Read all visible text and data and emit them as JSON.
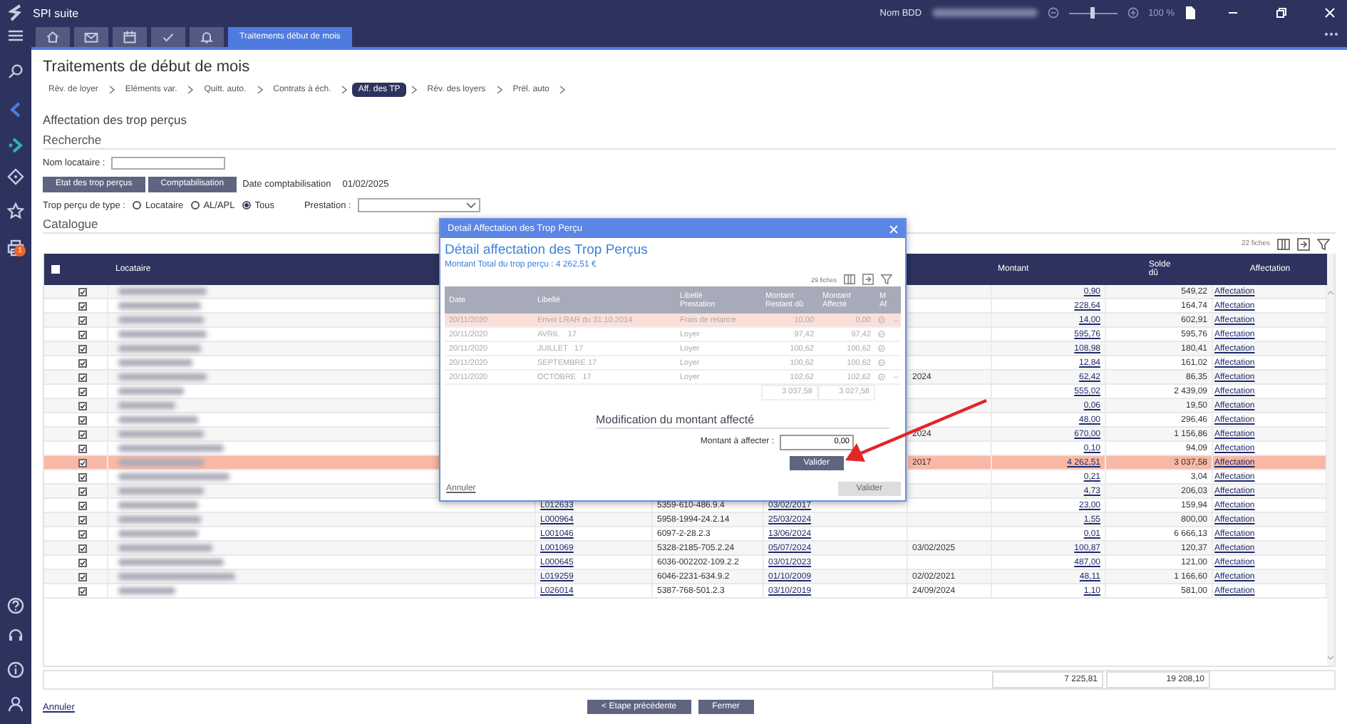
{
  "app": {
    "title": "SPI suite",
    "database_label": "Nom BDD",
    "zoom": {
      "level": 0.5,
      "reading": "100 %"
    }
  },
  "tabs": [
    {
      "kind": "icon",
      "selected": false
    },
    {
      "kind": "icon",
      "selected": false
    },
    {
      "kind": "icon",
      "selected": false
    },
    {
      "kind": "icon",
      "selected": false
    },
    {
      "kind": "icon",
      "selected": false
    },
    {
      "kind": "text",
      "label": "Traitements début de mois",
      "selected": true
    }
  ],
  "sidebar": {
    "notification_count": "1"
  },
  "page": {
    "title": "Traitements de début de mois",
    "section_title": "Affectation des trop perçus",
    "steps": [
      {
        "label": "Rév. de loyer",
        "selected": false
      },
      {
        "label": "Eléments var.",
        "selected": false
      },
      {
        "label": "Quitt. auto.",
        "selected": false
      },
      {
        "label": "Contrats à éch.",
        "selected": false
      },
      {
        "label": "Aff. des TP",
        "selected": true
      },
      {
        "label": "Rév. des loyers",
        "selected": false
      },
      {
        "label": "Prél. auto",
        "selected": false
      }
    ]
  },
  "search": {
    "heading": "Recherche",
    "name_label": "Nom locataire :",
    "buttons": [
      "Etat des trop perçus",
      "Comptabilisation"
    ],
    "date_label": "Date comptabilisation",
    "date_value": "01/02/2025",
    "type_label": "Trop perçu de type :",
    "type_options": [
      {
        "label": "Locataire",
        "selected": false
      },
      {
        "label": "AL/APL",
        "selected": false
      },
      {
        "label": "Tous",
        "selected": true
      }
    ],
    "prestation_label": "Prestation :"
  },
  "catalogue": {
    "heading": "Catalogue",
    "count": "22 fiches",
    "header_checked": false,
    "columns": {
      "tenant": "Locataire",
      "amount": "Montant",
      "balance": "Solde dû",
      "allocation": "Affectation"
    },
    "rows": [
      {
        "checked": true,
        "selected": false,
        "amount": "0,90",
        "balance": "549,22",
        "action": "Affectation"
      },
      {
        "checked": true,
        "selected": false,
        "amount": "228,64",
        "balance": "164,74",
        "action": "Affectation"
      },
      {
        "checked": true,
        "selected": false,
        "amount": "14,00",
        "balance": "602,91",
        "action": "Affectation"
      },
      {
        "checked": true,
        "selected": false,
        "amount": "595,76",
        "balance": "595,76",
        "action": "Affectation"
      },
      {
        "checked": true,
        "selected": false,
        "amount": "108,98",
        "balance": "180,41",
        "action": "Affectation"
      },
      {
        "checked": true,
        "selected": false,
        "amount": "12,84",
        "balance": "161,02",
        "action": "Affectation"
      },
      {
        "checked": true,
        "selected": false,
        "date_2": "2024",
        "amount": "62,42",
        "balance": "86,35",
        "action": "Affectation"
      },
      {
        "checked": true,
        "selected": false,
        "amount": "555,02",
        "balance": "2 439,09",
        "action": "Affectation"
      },
      {
        "checked": true,
        "selected": false,
        "amount": "0,06",
        "balance": "19,50",
        "action": "Affectation"
      },
      {
        "checked": true,
        "selected": false,
        "amount": "48,00",
        "balance": "296,46",
        "action": "Affectation"
      },
      {
        "checked": true,
        "selected": false,
        "date_2": "2024",
        "amount": "670,00",
        "balance": "1 156,86",
        "action": "Affectation"
      },
      {
        "checked": true,
        "selected": false,
        "amount": "0,10",
        "balance": "94,09",
        "action": "Affectation"
      },
      {
        "checked": true,
        "selected": true,
        "date_2": "2017",
        "amount": "4 262,51",
        "balance": "3 037,58",
        "action": "Affectation"
      },
      {
        "checked": true,
        "selected": false,
        "amount": "0,21",
        "balance": "3,04",
        "action": "Affectation"
      },
      {
        "checked": true,
        "selected": false,
        "amount": "4,73",
        "balance": "206,03",
        "action": "Affectation"
      },
      {
        "checked": true,
        "selected": false,
        "ref": "L012633",
        "code": "5359-610-486.9.4",
        "date": "03/02/2017",
        "amount": "23,00",
        "balance": "159,94",
        "action": "Affectation"
      },
      {
        "checked": true,
        "selected": false,
        "ref": "L000964",
        "code": "5958-1994-24.2.14",
        "date": "25/03/2024",
        "amount": "1,55",
        "balance": "800,00",
        "action": "Affectation"
      },
      {
        "checked": true,
        "selected": false,
        "ref": "L001046",
        "code": "6097-2-28.2.3",
        "date": "13/06/2024",
        "amount": "0,01",
        "balance": "6 666,13",
        "action": "Affectation"
      },
      {
        "checked": true,
        "selected": false,
        "ref": "L001069",
        "code": "5328-2185-705.2.24",
        "date": "05/07/2024",
        "date_2": "03/02/2025",
        "amount": "100,87",
        "balance": "120,37",
        "action": "Affectation"
      },
      {
        "checked": true,
        "selected": false,
        "ref": "L000645",
        "code": "6036-002202-109.2.2",
        "date": "03/01/2023",
        "amount": "487,00",
        "balance": "121,00",
        "action": "Affectation"
      },
      {
        "checked": true,
        "selected": false,
        "ref": "L019259",
        "code": "6046-2231-634.9.2",
        "date": "01/10/2009",
        "date_2": "02/02/2021",
        "amount": "48,11",
        "balance": "1 166,60",
        "action": "Affectation"
      },
      {
        "checked": true,
        "selected": false,
        "ref": "L026014",
        "code": "5387-768-501.2.3",
        "date": "03/10/2019",
        "date_2": "24/09/2024",
        "amount": "1,10",
        "balance": "581,00",
        "action": "Affectation"
      }
    ],
    "totals": {
      "amount": "7 225,81",
      "balance": "19 208,10"
    }
  },
  "footer": {
    "cancel": "Annuler",
    "back": "< Etape précédente",
    "close": "Fermer"
  },
  "dialog": {
    "title": "Detail Affectation des Trop Perçu",
    "heading": "Détail affectation des Trop Perçus",
    "total": "Montant Total du trop perçu : 4 262,51 €",
    "count": "29 fiches",
    "columns": [
      "Date",
      "Libellé",
      "Libellé Prestation",
      "Montant Restant dû",
      "Montant Affecté",
      "M Af"
    ],
    "rows": [
      {
        "date": "20/11/2020",
        "label": "Envoi LRAR du 31.10.2014",
        "service": "Frais de relance",
        "remaining": "10,00",
        "allocated": "0,00",
        "selected": true
      },
      {
        "date": "20/11/2020",
        "label": "AVRIL    17",
        "service": "Loyer",
        "remaining": "97,42",
        "allocated": "97,42",
        "selected": false
      },
      {
        "date": "20/11/2020",
        "label": "JUILLET   17",
        "service": "Loyer",
        "remaining": "100,62",
        "allocated": "100,62",
        "selected": false
      },
      {
        "date": "20/11/2020",
        "label": "SEPTEMBRE 17",
        "service": "Loyer",
        "remaining": "100,62",
        "allocated": "100,62",
        "selected": false
      },
      {
        "date": "20/11/2020",
        "label": "OCTOBRE   17",
        "service": "Loyer",
        "remaining": "102,62",
        "allocated": "102,62",
        "selected": false
      }
    ],
    "totals": {
      "remaining": "3 037,58",
      "allocated": "3 027,58"
    },
    "modification_heading": "Modification du montant affecté",
    "amount_label": "Montant à affecter :",
    "amount_value": "0,00",
    "confirm": {
      "label": "Valider",
      "disabled": false
    },
    "cancel": "Annuler",
    "submit": {
      "label": "Valider",
      "disabled": true
    }
  }
}
